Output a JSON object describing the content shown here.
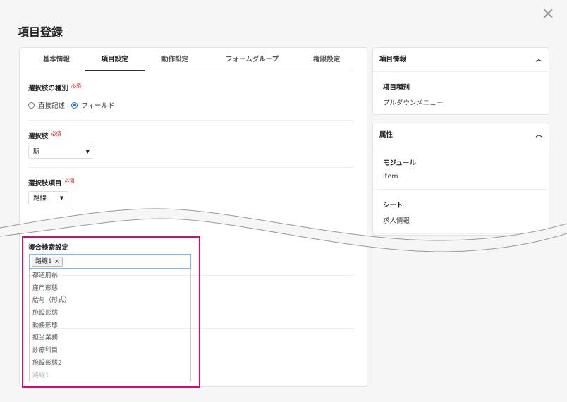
{
  "title": "項目登録",
  "close_icon": "close-icon",
  "tabs": [
    {
      "label": "基本情報"
    },
    {
      "label": "項目設定"
    },
    {
      "label": "動作設定"
    },
    {
      "label": "フォームグループ"
    },
    {
      "label": "権限設定"
    }
  ],
  "active_tab": "項目設定",
  "required": "必須",
  "choice_type": {
    "label": "選択肢の種別",
    "options": [
      {
        "label": "直接記述",
        "checked": false
      },
      {
        "label": "フィールド",
        "checked": true
      }
    ]
  },
  "choice": {
    "label": "選択肢",
    "value": "駅"
  },
  "choice_item": {
    "label": "選択肢項目",
    "value": "路線"
  },
  "compound": {
    "label": "複合検索設定",
    "chips": [
      "路線1"
    ],
    "options": [
      "都道府県",
      "雇用形態",
      "給与（形式）",
      "施設形態",
      "勤務形態",
      "担当業務",
      "診療科目",
      "施設形態2",
      "路線1"
    ],
    "disabled_option": "路線1"
  },
  "item_info": {
    "title": "項目情報",
    "key": "項目種別",
    "value": "プルダウンメニュー"
  },
  "attributes": {
    "title": "属性",
    "rows": [
      {
        "key": "モジュール",
        "value": "item"
      },
      {
        "key": "シート",
        "value": "求人情報"
      }
    ]
  },
  "colors": {
    "highlight": "#e4007f",
    "radio": "#1a73e8"
  }
}
